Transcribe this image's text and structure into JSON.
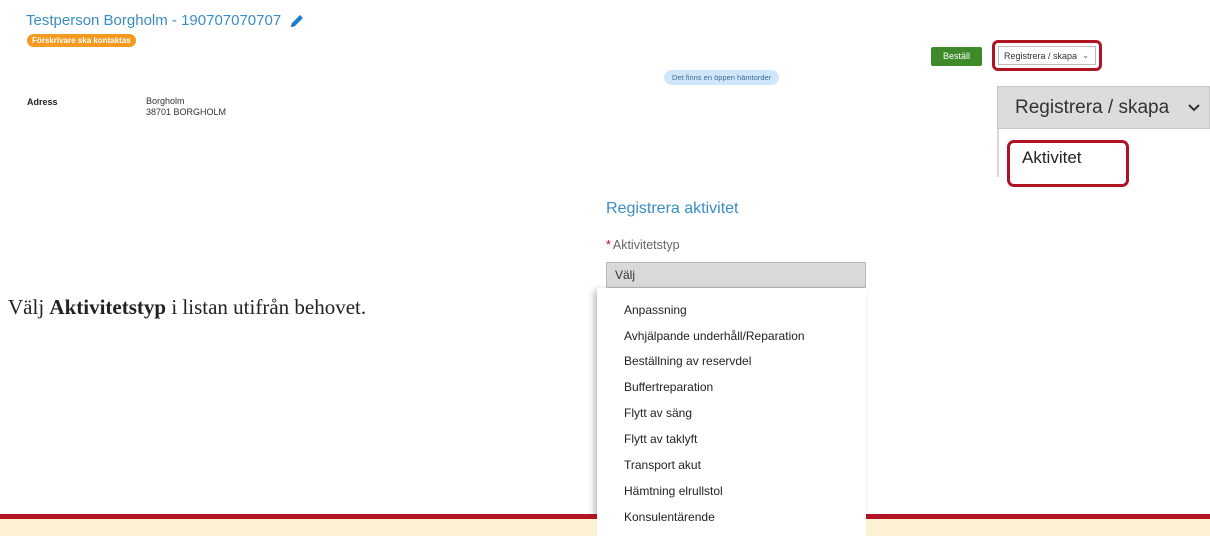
{
  "person": {
    "name": "Testperson Borgholm - 190707070707",
    "badge": "Förskrivare ska kontaktas",
    "adress_label": "Adress",
    "adress_line1": "Borgholm",
    "adress_line2": "38701 BORGHOLM"
  },
  "status_badge": "Det finns en öppen hämtorder",
  "toolbar": {
    "bestall_label": "Beställ",
    "registrera_label": "Registrera / skapa"
  },
  "zoom_menu": {
    "registrera_label": "Registrera / skapa",
    "item_aktivitet": "Aktivitet"
  },
  "form": {
    "title": "Registrera aktivitet",
    "required_mark": "*",
    "field_label": "Aktivitetstyp",
    "select_value": "Välj"
  },
  "activity_options": [
    "Anpassning",
    "Avhjälpande underhåll/Reparation",
    "Beställning av reservdel",
    "Buffertreparation",
    "Flytt av säng",
    "Flytt av taklyft",
    "Transport akut",
    "Hämtning elrullstol",
    "Konsulentärende"
  ],
  "instruction": {
    "prefix": "Välj ",
    "bold": "Aktivitetstyp",
    "suffix": " i listan utifrån behovet."
  },
  "colors": {
    "link_blue": "#3a8dc4",
    "orange_badge": "#f39a1f",
    "green_button": "#3e8a2a",
    "highlight_red": "#b01322",
    "footer_cream": "#fdf1d4"
  }
}
